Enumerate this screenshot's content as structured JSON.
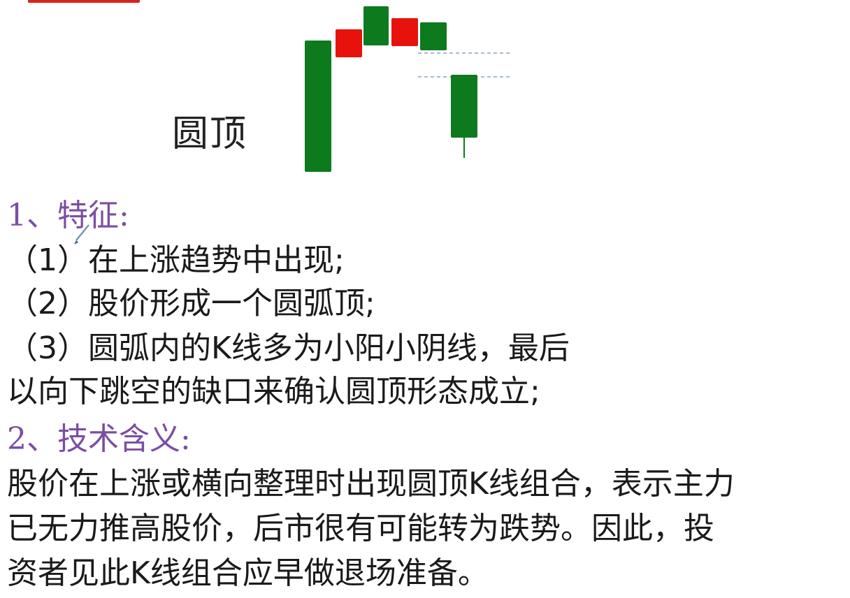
{
  "pattern": {
    "label": "圆顶"
  },
  "candles_chart": {
    "colors": {
      "bull": "#e8120c",
      "bear": "#0d7a1e",
      "gap_line": "#8aa0c8"
    }
  },
  "section1": {
    "heading": "1、特征:",
    "items": [
      "（1）在上涨趋势中出现;",
      "（2）股价形成一个圆弧顶;",
      "（3）圆弧内的K线多为小阳小阴线，最后",
      "以向下跳空的缺口来确认圆顶形态成立;"
    ]
  },
  "section2": {
    "heading": "2、技术含义:",
    "lines": [
      "股价在上涨或横向整理时出现圆顶K线组合，表示主力",
      "已无力推高股价，后市很有可能转为跌势。因此，投",
      "资者见此K线组合应早做退场准备。"
    ]
  }
}
